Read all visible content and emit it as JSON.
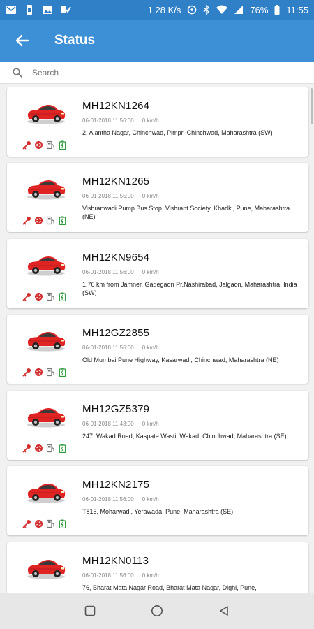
{
  "statusbar": {
    "speed": "1.28 K/s",
    "battery": "76%",
    "time": "11:55"
  },
  "appbar": {
    "title": "Status"
  },
  "search": {
    "placeholder": "Search"
  },
  "vehicles": [
    {
      "plate": "MH12KN1264",
      "time": "06-01-2018 11:56:00",
      "speed": "0 km/h",
      "address": "2, Ajantha Nagar, Chinchwad, Pimpri-Chinchwad, Maharashtra (SW)"
    },
    {
      "plate": "MH12KN1265",
      "time": "06-01-2018 11:55:00",
      "speed": "0 km/h",
      "address": "Vishranwadi Pump Bus Stop, Vishrant Society, Khadki, Pune, Maharashtra (NE)"
    },
    {
      "plate": "MH12KN9654",
      "time": "06-01-2018 11:56:00",
      "speed": "0 km/h",
      "address": "1.76 km from Jamner, Gadegaon Pr.Nashirabad, Jalgaon, Maharashtra, India (SW)"
    },
    {
      "plate": "MH12GZ2855",
      "time": "06-01-2018 11:56:00",
      "speed": "0 km/h",
      "address": "Old Mumbai Pune Highway, Kasarwadi, Chinchwad, Maharashtra (NE)"
    },
    {
      "plate": "MH12GZ5379",
      "time": "06-01-2018 11:43:00",
      "speed": "0 km/h",
      "address": "247, Wakad Road, Kaspate Wasti, Wakad, Chinchwad, Maharashtra (SE)"
    },
    {
      "plate": "MH12KN2175",
      "time": "06-01-2018 11:56:00",
      "speed": "0 km/h",
      "address": "T815, Moharwadi, Yerawada, Pune, Maharashtra (SE)"
    },
    {
      "plate": "MH12KN0113",
      "time": "06-01-2018 11:56:00",
      "speed": "0 km/h",
      "address": "76, Bharat Mata Nagar Road, Bharat Mata Nagar, Dighi, Pune,"
    }
  ],
  "colors": {
    "appbar": "#3d8fd6",
    "statusbar": "#2f80c6",
    "ignition_red": "#d32f2f",
    "battery_green": "#2e9b3e",
    "car_red": "#e02424"
  },
  "icons": {
    "back": "arrow-left-icon",
    "search": "search-icon",
    "card_icons": [
      "key-icon",
      "wheel-icon",
      "fuel-icon",
      "battery-icon"
    ],
    "nav": [
      "recents-icon",
      "home-icon",
      "back-triangle-icon"
    ]
  }
}
